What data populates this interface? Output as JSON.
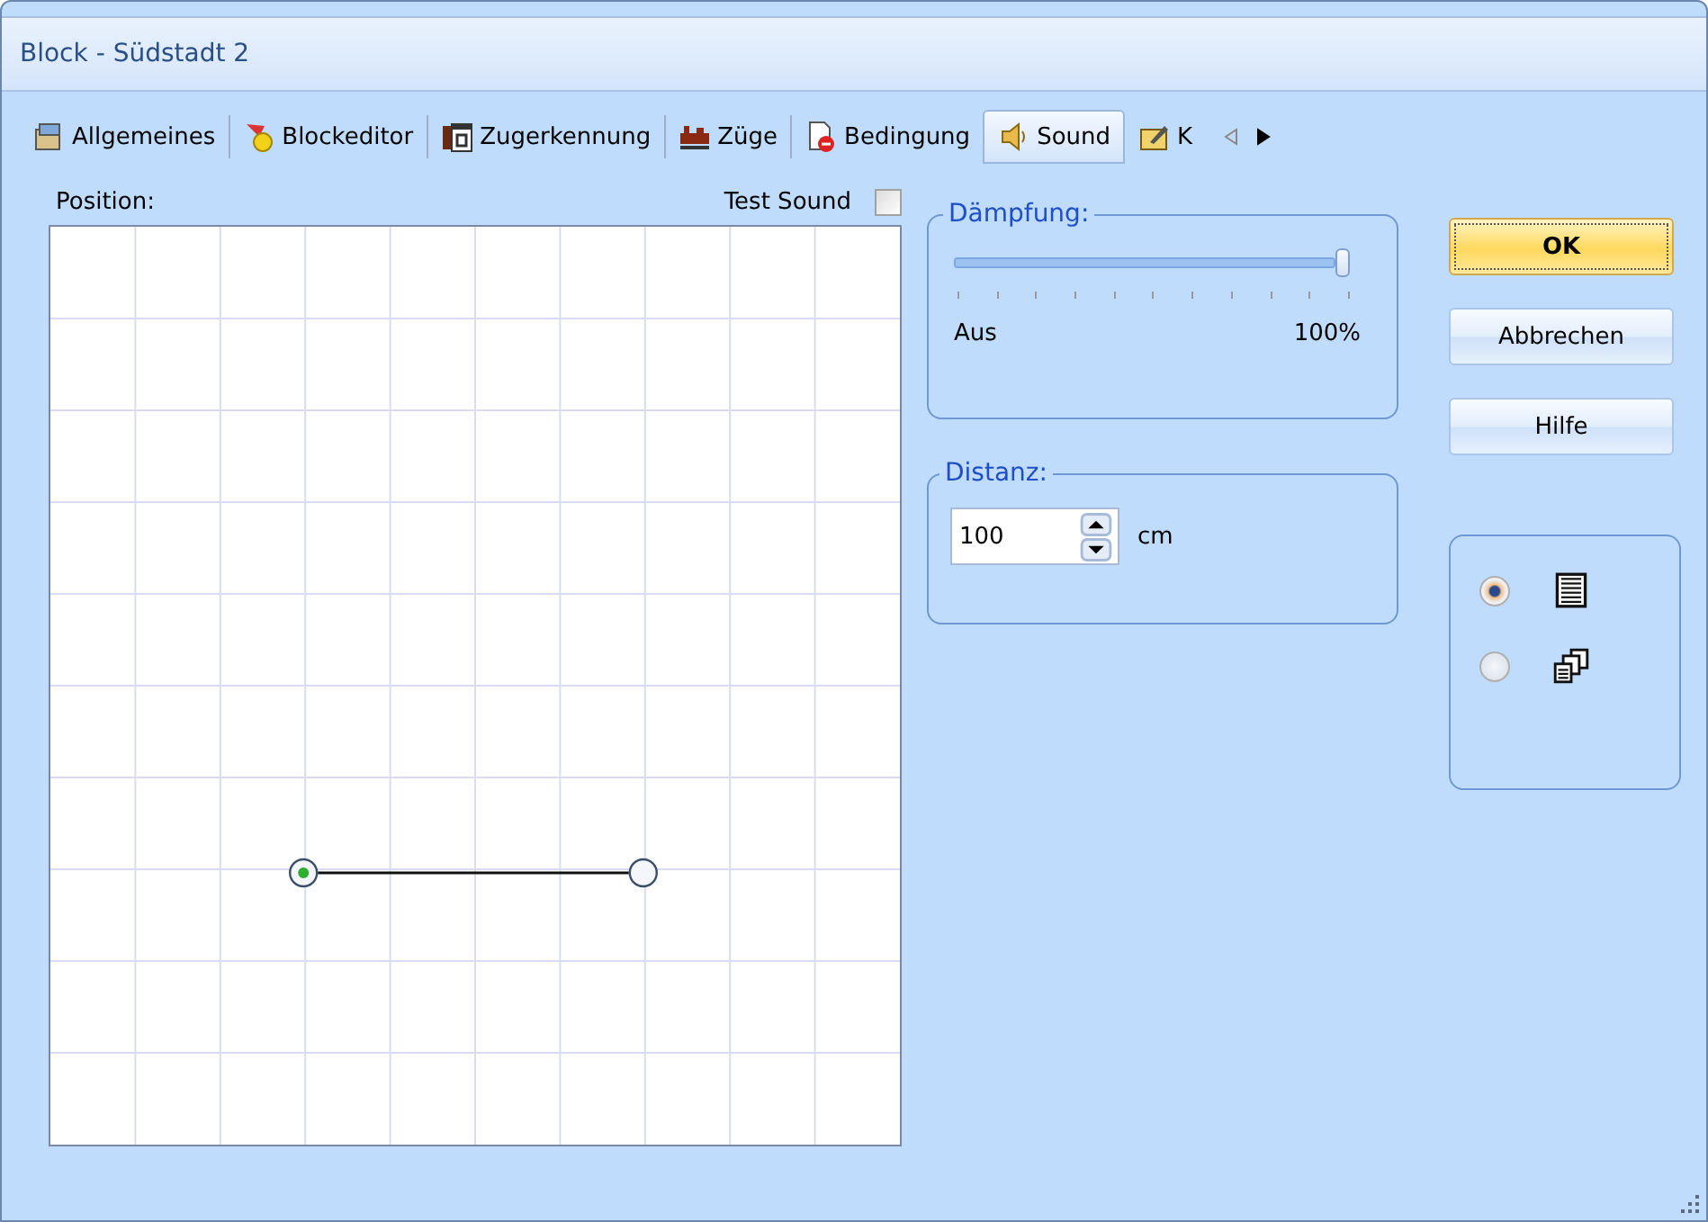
{
  "window": {
    "title": "Block - Südstadt 2"
  },
  "tabs": [
    {
      "label": "Allgemeines",
      "selected": false
    },
    {
      "label": "Blockeditor",
      "selected": false
    },
    {
      "label": "Zugerkennung",
      "selected": false
    },
    {
      "label": "Züge",
      "selected": false
    },
    {
      "label": "Bedingung",
      "selected": false
    },
    {
      "label": "Sound",
      "selected": true
    },
    {
      "label": "K",
      "selected": false
    }
  ],
  "tab_scroll": {
    "left_disabled": true,
    "right_disabled": false
  },
  "position": {
    "label": "Position:",
    "points": [
      {
        "selected": true
      },
      {
        "selected": false
      }
    ]
  },
  "test_sound": {
    "label": "Test Sound",
    "checked": false
  },
  "daempfung": {
    "title": "Dämpfung:",
    "level": 1,
    "min_label": "Aus",
    "max_label": "100%"
  },
  "distanz": {
    "title": "Distanz:",
    "value": "100",
    "unit": "cm"
  },
  "buttons": [
    {
      "label": "OK",
      "default": true
    },
    {
      "label": "Abbrechen",
      "default": false
    },
    {
      "label": "Hilfe",
      "default": false
    }
  ],
  "view_options": [
    {
      "selected": true
    },
    {
      "selected": false
    }
  ]
}
